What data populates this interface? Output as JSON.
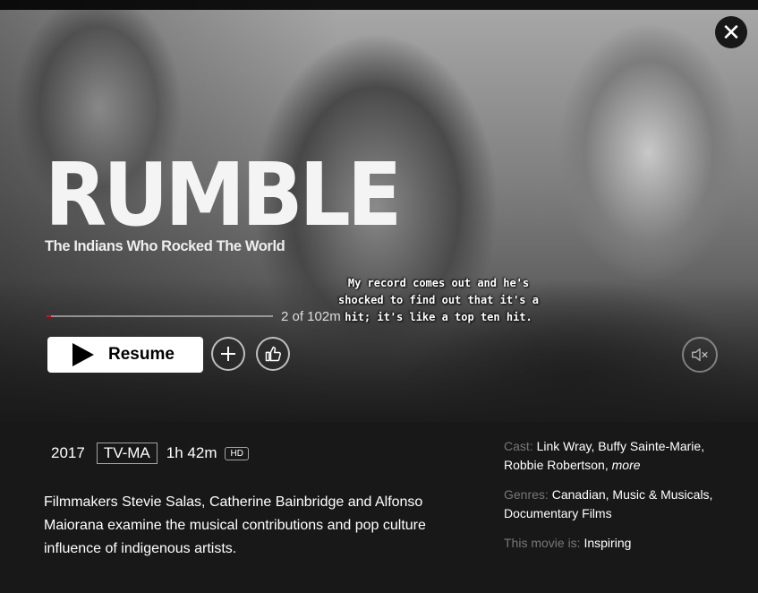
{
  "hero": {
    "logo_title": "RUMBLE",
    "logo_subtitle": "The Indians Who Rocked The World",
    "subtitle_caption": "My record comes out and he's\nshocked to find out that it's a\nhit; it's like a top ten hit.",
    "progress_label": "2 of 102m",
    "progress_fraction": 0.02,
    "resume_label": "Resume",
    "icons": {
      "close": "close-icon",
      "play": "play-icon",
      "add": "plus-icon",
      "like": "thumbs-up-icon",
      "mute": "volume-muted-icon"
    },
    "colors": {
      "progress": "#e50914",
      "background": "#181818"
    }
  },
  "details": {
    "year": "2017",
    "rating": "TV-MA",
    "duration": "1h 42m",
    "quality": "HD",
    "synopsis": "Filmmakers Stevie Salas, Catherine Bainbridge and Alfonso Maiorana examine the musical contributions and pop culture influence of indigenous artists.",
    "cast_label": "Cast:",
    "cast": "Link Wray, Buffy Sainte-Marie, Robbie Robertson,",
    "more_label": "more",
    "genres_label": "Genres:",
    "genres": "Canadian, Music & Musicals, Documentary Films",
    "mood_label": "This movie is:",
    "mood": "Inspiring"
  }
}
